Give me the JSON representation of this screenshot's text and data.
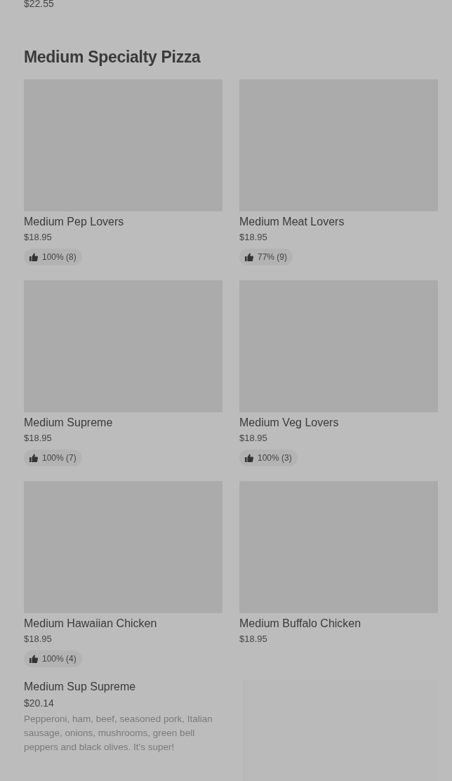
{
  "previous_item": {
    "price": "$22.55"
  },
  "section": {
    "title": "Medium Specialty Pizza",
    "items": [
      {
        "kind": "card",
        "name": "Medium Pep Lovers",
        "price": "$18.95",
        "rating": "100% (8)"
      },
      {
        "kind": "card",
        "name": "Medium Meat Lovers",
        "price": "$18.95",
        "rating": "77% (9)"
      },
      {
        "kind": "card",
        "name": "Medium Supreme",
        "price": "$18.95",
        "rating": "100% (7)"
      },
      {
        "kind": "card",
        "name": "Medium Veg Lovers",
        "price": "$18.95",
        "rating": "100% (3)"
      },
      {
        "kind": "card",
        "name": "Medium Hawaiian Chicken",
        "price": "$18.95",
        "rating": "100% (4)"
      },
      {
        "kind": "card",
        "name": "Medium Buffalo Chicken",
        "price": "$18.95"
      },
      {
        "kind": "row",
        "name": "Medium Sup Supreme",
        "price": "$20.14",
        "description": "Pepperoni, ham, beef, seasoned pork, Italian sausage, onions, mushrooms, green bell peppers and black olives. It's super!"
      }
    ]
  }
}
